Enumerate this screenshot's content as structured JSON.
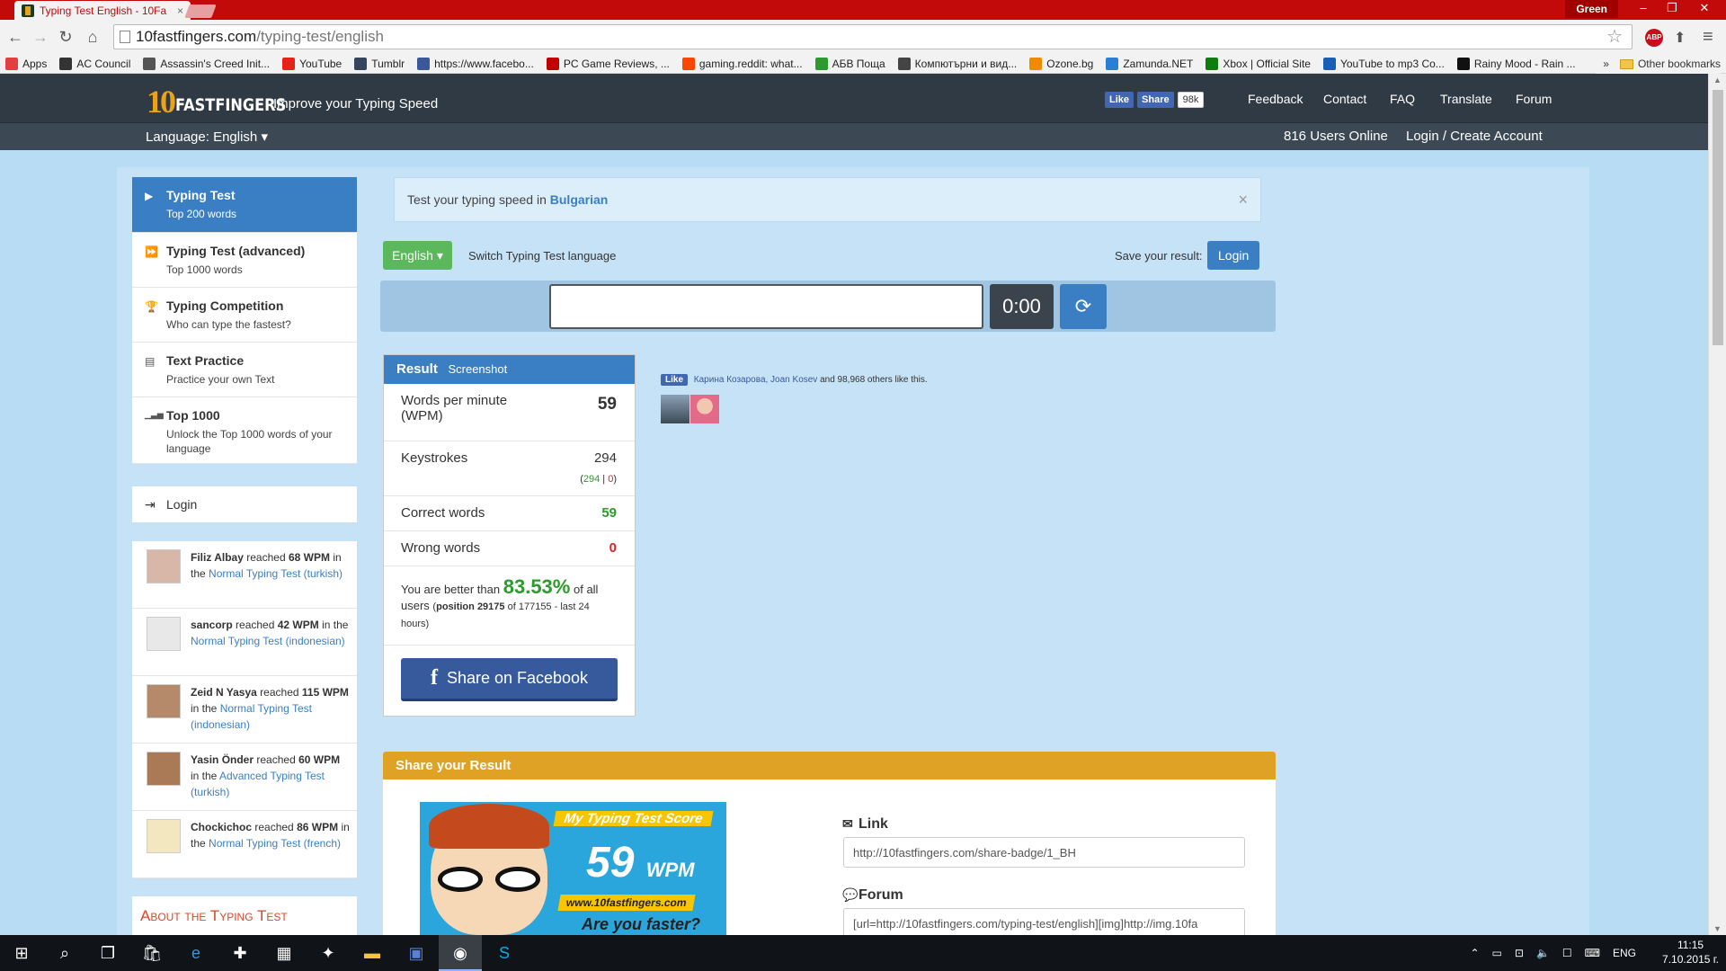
{
  "browser": {
    "tab_title": "Typing Test English - 10Fa",
    "profile": "Green",
    "url_host": "10fastfingers.com",
    "url_path": "/typing-test/english",
    "bookmarks": [
      {
        "label": "Apps",
        "color": "#e04040"
      },
      {
        "label": "AC Council",
        "color": "#333333"
      },
      {
        "label": "Assassin's Creed Init...",
        "color": "#555555"
      },
      {
        "label": "YouTube",
        "color": "#e62117"
      },
      {
        "label": "Tumblr",
        "color": "#35465c"
      },
      {
        "label": "https://www.facebo...",
        "color": "#3b5998"
      },
      {
        "label": "PC Game Reviews, ...",
        "color": "#c00000"
      },
      {
        "label": "gaming.reddit: what...",
        "color": "#ff4500"
      },
      {
        "label": "АБВ Поща",
        "color": "#2c9a2c"
      },
      {
        "label": "Компютърни и вид...",
        "color": "#444444"
      },
      {
        "label": "Ozone.bg",
        "color": "#f08a00"
      },
      {
        "label": "Zamunda.NET",
        "color": "#2a7fd4"
      },
      {
        "label": "Xbox | Official Site",
        "color": "#107c10"
      },
      {
        "label": "YouTube to mp3 Co...",
        "color": "#1a5fb4"
      },
      {
        "label": "Rainy Mood - Rain ...",
        "color": "#111111"
      }
    ],
    "bookmarks_more": "»",
    "other_bookmarks": "Other bookmarks",
    "abp_label": "ABP"
  },
  "header": {
    "logo_num": "10",
    "logo_text": "FASTFINGERS",
    "tagline": "Improve your Typing Speed",
    "fb_like": "Like",
    "fb_share": "Share",
    "fb_count": "98k",
    "nav": [
      "Feedback",
      "Contact",
      "FAQ",
      "Translate",
      "Forum"
    ],
    "language": "Language: English",
    "users_online": "816 Users Online",
    "login_create": "Login / Create Account"
  },
  "sidebar": {
    "items": [
      {
        "title": "Typing Test",
        "subtitle": "Top 200 words",
        "icon": "▶"
      },
      {
        "title": "Typing Test (advanced)",
        "subtitle": "Top 1000 words",
        "icon": "⏩"
      },
      {
        "title": "Typing Competition",
        "subtitle": "Who can type the fastest?",
        "icon": "🏆"
      },
      {
        "title": "Text Practice",
        "subtitle": "Practice your own Text",
        "icon": "▤"
      },
      {
        "title": "Top 1000",
        "subtitle": "Unlock the Top 1000 words of your language",
        "icon": "▁▃▅"
      }
    ],
    "login": "Login",
    "feed": [
      {
        "name": "Filiz Albay",
        "pre": "reached",
        "wpm": "68 WPM",
        "mid": "in the",
        "test": "Normal Typing Test",
        "lang": "(turkish)"
      },
      {
        "name": "sancorp",
        "pre": "reached",
        "wpm": "42 WPM",
        "mid": "in the",
        "test": "Normal Typing Test",
        "lang": "(indonesian)"
      },
      {
        "name": "Zeid N Yasya",
        "pre": "reached",
        "wpm": "115 WPM",
        "mid": "in the",
        "test": "Normal Typing Test",
        "lang": "(indonesian)"
      },
      {
        "name": "Yasin Önder",
        "pre": "reached",
        "wpm": "60 WPM",
        "mid": "in the",
        "test": "Advanced Typing Test",
        "lang": "(turkish)"
      },
      {
        "name": "Chockichoc",
        "pre": "reached",
        "wpm": "86 WPM",
        "mid": "in the",
        "test": "Normal Typing Test",
        "lang": "(french)"
      }
    ],
    "about": "About the Typing Test"
  },
  "main": {
    "notice_text": "Test your typing speed in",
    "notice_lang": "Bulgarian",
    "close": "×",
    "lang_button": "English",
    "switch_label": "Switch Typing Test language",
    "save_label": "Save your result:",
    "login_button": "Login",
    "input_value": "",
    "timer": "0:00"
  },
  "result": {
    "title": "Result",
    "screenshot": "Screenshot",
    "wpm_label": "Words per minute (WPM)",
    "wpm": "59",
    "keystrokes_label": "Keystrokes",
    "keystrokes": "294",
    "keystrokes_correct": "294",
    "keystrokes_wrong": "0",
    "correct_label": "Correct words",
    "correct": "59",
    "wrong_label": "Wrong words",
    "wrong": "0",
    "better_pre": "You are better than",
    "better_pct": "83.53%",
    "better_post": "of all users",
    "position_label": "position",
    "position": "29175",
    "of_label": "of",
    "total": "177155",
    "period": "- last 24 hours)",
    "share_fb": "Share on Facebook"
  },
  "fb_widget": {
    "like": "Like",
    "names": "Карина Козарова, Joan Kosev",
    "rest": "and 98,968 others like this."
  },
  "share": {
    "title": "Share your Result",
    "badge_title": "My Typing Test Score",
    "badge_score": "59",
    "badge_unit": "WPM",
    "badge_site": "www.10fastfingers.com",
    "badge_cta": "Are you faster?",
    "link_label": "Link",
    "link_value": "http://10fastfingers.com/share-badge/1_BH",
    "forum_label": "Forum",
    "forum_value": "[url=http://10fastfingers.com/typing-test/english][img]http://img.10fa"
  },
  "taskbar": {
    "tray_lang": "ENG",
    "time": "11:15",
    "date": "7.10.2015 г."
  }
}
